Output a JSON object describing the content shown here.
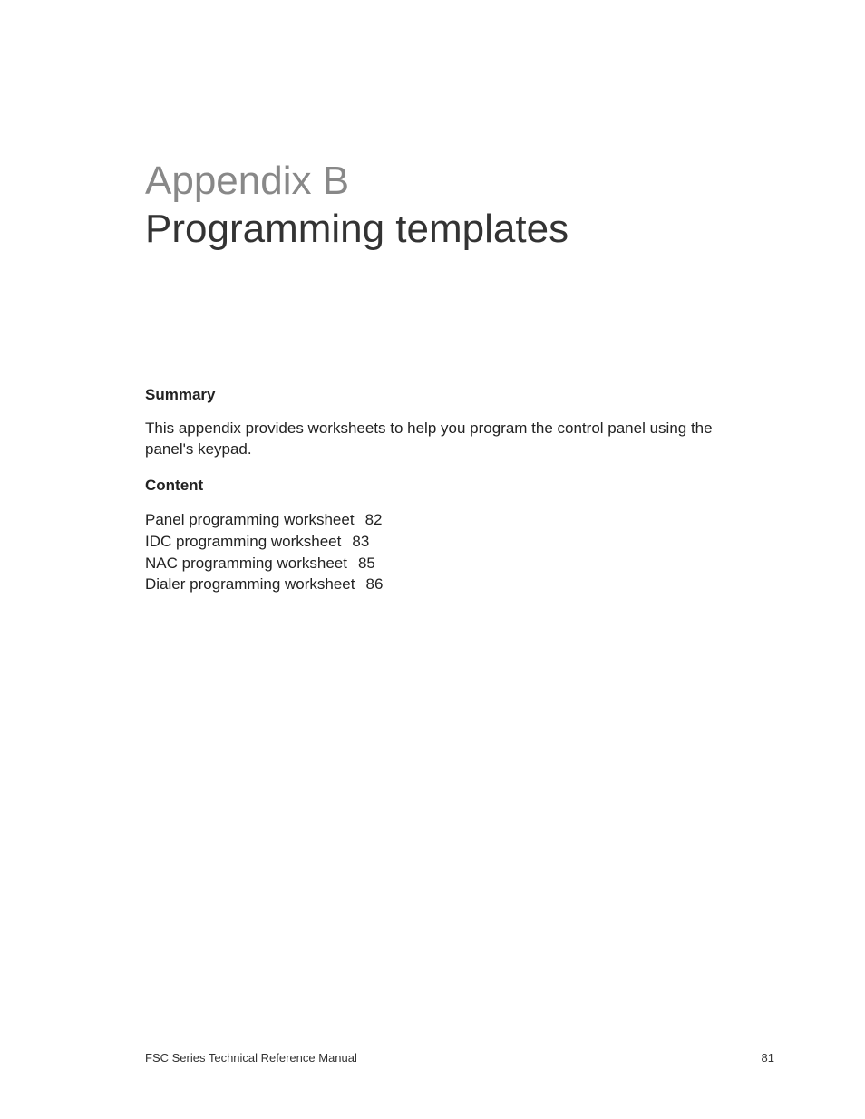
{
  "header": {
    "appendix_label": "Appendix B",
    "title": "Programming templates"
  },
  "summary": {
    "heading": "Summary",
    "text": "This appendix provides worksheets to help you program the control panel using the panel's keypad."
  },
  "content": {
    "heading": "Content",
    "items": [
      {
        "label": "Panel programming worksheet",
        "page": "82"
      },
      {
        "label": "IDC programming worksheet",
        "page": "83"
      },
      {
        "label": "NAC programming worksheet",
        "page": "85"
      },
      {
        "label": "Dialer programming worksheet",
        "page": "86"
      }
    ]
  },
  "footer": {
    "doc_title": "FSC Series Technical Reference Manual",
    "page_number": "81"
  }
}
